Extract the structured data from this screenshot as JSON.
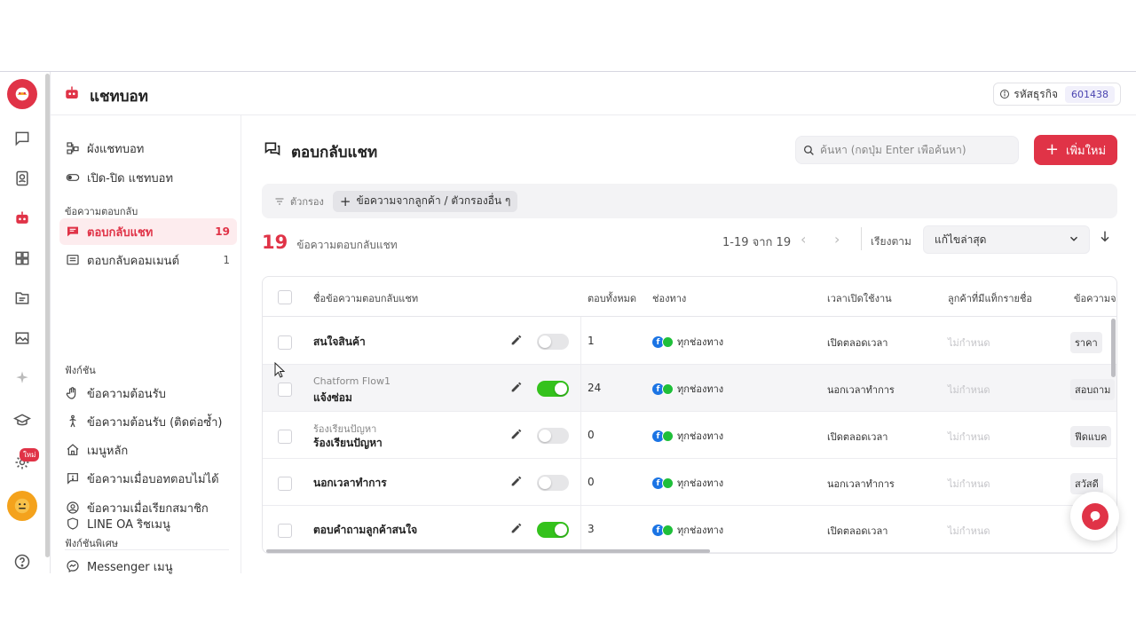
{
  "colors": {
    "accent": "#e03347",
    "toggle_on": "#34c21c",
    "facebook": "#1b74e4",
    "line": "#1fbf3a",
    "business_code": "#4a44b0"
  },
  "header": {
    "title": "แชทบอท",
    "business_label": "รหัสธุรกิจ",
    "business_code": "601438",
    "badge_new": "ใหม่"
  },
  "sidebar": {
    "items_top": [
      {
        "label": "ผังแชทบอท",
        "icon": "flow-icon"
      },
      {
        "label": "เปิด-ปิด แชทบอท",
        "icon": "toggle-icon"
      }
    ],
    "section_reply": "ข้อความตอบกลับ",
    "reply_items": [
      {
        "label": "ตอบกลับแชท",
        "count": "19",
        "icon": "chat-icon"
      },
      {
        "label": "ตอบกลับคอมเมนต์",
        "count": "1",
        "icon": "comment-icon"
      }
    ],
    "section_functions": "ฟังก์ชัน",
    "function_items": [
      {
        "label": "ข้อความต้อนรับ",
        "icon": "wave-icon"
      },
      {
        "label": "ข้อความต้อนรับ (ติดต่อซ้ำ)",
        "icon": "person-icon"
      },
      {
        "label": "เมนูหลัก",
        "icon": "home-icon"
      },
      {
        "label": "ข้อความเมื่อบอทตอบไม่ได้",
        "icon": "alert-chat-icon"
      },
      {
        "label": "ข้อความเมื่อเรียกสมาชิก",
        "icon": "user-circle-icon"
      }
    ],
    "section_special": "ฟังก์ชันพิเศษ",
    "special_items": [
      {
        "label": "Messenger เมนู",
        "icon": "messenger-icon"
      },
      {
        "label": "LINE OA ริชเมนู",
        "icon": "shield-icon"
      }
    ]
  },
  "main": {
    "title": "ตอบกลับแชท",
    "search_placeholder": "ค้นหา (กดปุ่ม Enter เพื่อค้นหา)",
    "add_label": "เพิ่มใหม่",
    "filter_label": "ตัวกรอง",
    "filter_chip": "ข้อความจากลูกค้า / ตัวกรองอื่น ๆ",
    "count": "19",
    "count_label": "ข้อความตอบกลับแชท",
    "pagination": "1-19 จาก 19",
    "sort_label": "เรียงตาม",
    "sort_value": "แก้ไขล่าสุด"
  },
  "table": {
    "headers": {
      "name": "ชื่อข้อความตอบกลับแชท",
      "total": "ตอบทั้งหมด",
      "channel": "ช่องทาง",
      "active_time": "เวลาเปิดใช้งาน",
      "tagged": "ลูกค้าที่มีแท็กรายชื่อ",
      "message": "ข้อความจา"
    },
    "rows": [
      {
        "sub": "",
        "name": "สนใจสินค้า",
        "enabled": false,
        "total": "1",
        "channel": "ทุกช่องทาง",
        "time": "เปิดตลอดเวลา",
        "tag": "ไม่กำหนด",
        "msg": "ราคา"
      },
      {
        "sub": "Chatform Flow1",
        "name": "แจ้งซ่อม",
        "enabled": true,
        "total": "24",
        "channel": "ทุกช่องทาง",
        "time": "นอกเวลาทำการ",
        "tag": "ไม่กำหนด",
        "msg": "สอบถาม"
      },
      {
        "sub": "ร้องเรียนปัญหา",
        "name": "ร้องเรียนปัญหา",
        "enabled": false,
        "total": "0",
        "channel": "ทุกช่องทาง",
        "time": "เปิดตลอดเวลา",
        "tag": "ไม่กำหนด",
        "msg": "ฟีดแบค"
      },
      {
        "sub": "",
        "name": "นอกเวลาทำการ",
        "enabled": false,
        "total": "0",
        "channel": "ทุกช่องทาง",
        "time": "นอกเวลาทำการ",
        "tag": "ไม่กำหนด",
        "msg": "สวัสดี"
      },
      {
        "sub": "",
        "name": "ตอบคำถามลูกค้าสนใจ",
        "enabled": true,
        "total": "3",
        "channel": "ทุกช่องทาง",
        "time": "เปิดตลอดเวลา",
        "tag": "ไม่กำหนด",
        "msg": ""
      }
    ]
  }
}
